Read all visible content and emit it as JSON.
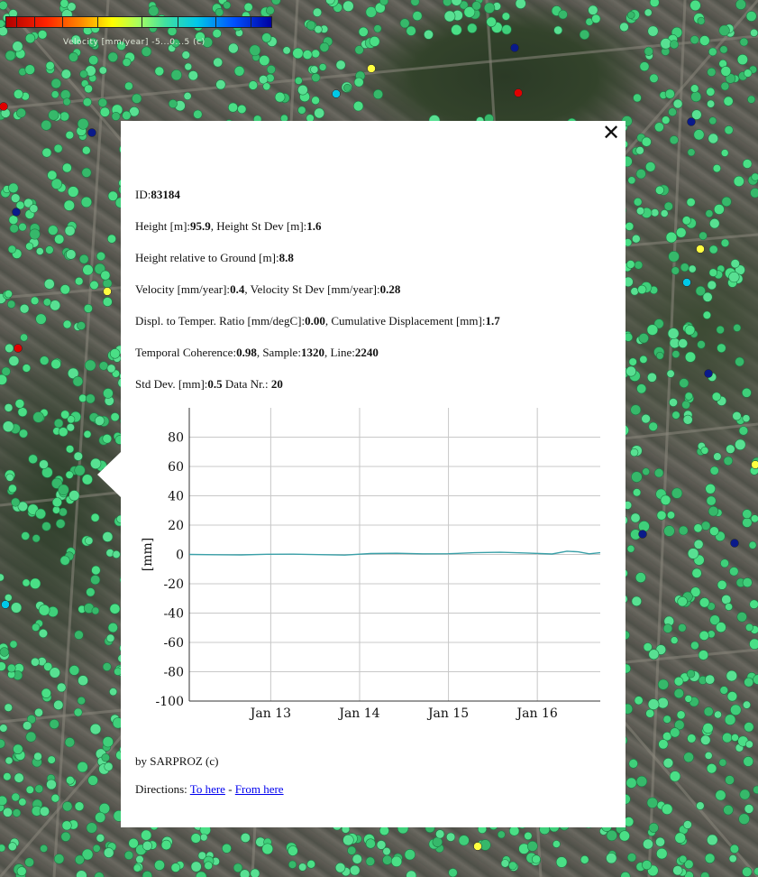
{
  "legend": {
    "colors": [
      "#b00000",
      "#ff2200",
      "#ff8800",
      "#ffff00",
      "#a8ff60",
      "#40e0a0",
      "#00c8e8",
      "#0050ff",
      "#0000a0"
    ],
    "label": "Velocity [mm/year] -5...0...5 (c)"
  },
  "popup": {
    "close_label": "✕",
    "id_label": "ID:",
    "id_value": "83184",
    "height_label": "Height [m]:",
    "height_value": "95.9",
    "height_sd_label": ", Height St Dev [m]:",
    "height_sd_value": "1.6",
    "hrel_label": "Height relative to Ground [m]:",
    "hrel_value": "8.8",
    "vel_label": "Velocity [mm/year]:",
    "vel_value": "0.4",
    "vel_sd_label": ", Velocity St Dev [mm/year]:",
    "vel_sd_value": "0.28",
    "displ_label": "Displ. to Temper. Ratio [mm/degC]:",
    "displ_value": "0.00",
    "cum_label": ", Cumulative Displacement [mm]:",
    "cum_value": "1.7",
    "coh_label": "Temporal Coherence:",
    "coh_value": "0.98",
    "sample_label": ", Sample:",
    "sample_value": "1320",
    "line_label": ", Line:",
    "line_value": "2240",
    "std_label": "Std Dev. [mm]:",
    "std_value": "0.5",
    "datanr_label": " Data Nr.: ",
    "datanr_value": "20",
    "footer": "by SARPROZ (c)",
    "directions_label": "Directions: ",
    "to_here": "To here",
    "separator": " - ",
    "from_here": "From here"
  },
  "chart_data": {
    "type": "line",
    "ylabel": "[mm]",
    "ylim": [
      -100,
      100
    ],
    "yticks": [
      80,
      60,
      40,
      20,
      0,
      -20,
      -40,
      -60,
      -80,
      -100
    ],
    "xlim": [
      "Jan 12 2:00",
      "Jan 16 17:00"
    ],
    "xticks": [
      "Jan 13",
      "Jan 14",
      "Jan 15",
      "Jan 16"
    ],
    "grid": true,
    "series_color": "#3aa0a8",
    "series": [
      {
        "x": [
          "Jan 12 2:00",
          "Jan 12 9:00",
          "Jan 12 16:00",
          "Jan 12 23:00",
          "Jan 13 6:00",
          "Jan 13 13:00",
          "Jan 13 20:00",
          "Jan 14 3:00",
          "Jan 14 10:00",
          "Jan 14 17:00",
          "Jan 15 0:00",
          "Jan 15 7:00",
          "Jan 15 14:00",
          "Jan 15 21:00",
          "Jan 16 4:00",
          "Jan 16 8:00",
          "Jan 16 11:00",
          "Jan 16 14:00",
          "Jan 16 17:00"
        ],
        "values": [
          0.0,
          -0.2,
          -0.3,
          0.1,
          0.2,
          -0.1,
          -0.4,
          0.6,
          0.8,
          0.4,
          0.5,
          1.2,
          1.5,
          1.0,
          0.3,
          2.2,
          1.8,
          0.4,
          1.2
        ]
      }
    ]
  }
}
